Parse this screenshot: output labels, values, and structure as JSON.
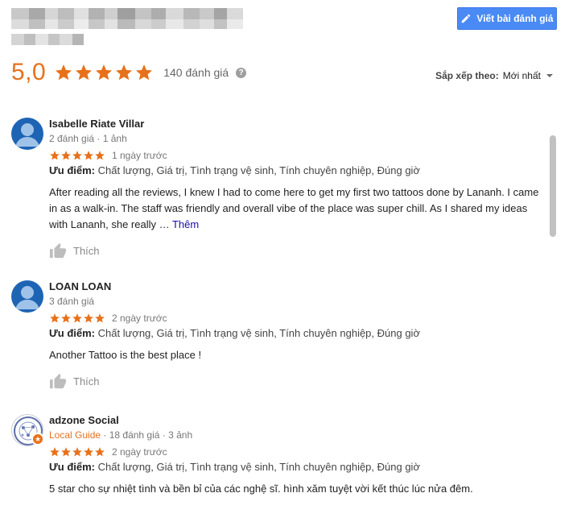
{
  "header": {
    "write_review_label": "Viết bài đánh giá"
  },
  "summary": {
    "score": "5,0",
    "rating": 5,
    "review_count": "140 đánh giá",
    "help_icon": "?"
  },
  "sort": {
    "label": "Sắp xếp theo:",
    "value": "Mới nhất"
  },
  "colors": {
    "star": "#e7711b",
    "accent_button": "#4a8af4",
    "link": "#1a0dab",
    "avatar": "#1e64b4"
  },
  "reviews": [
    {
      "name": "Isabelle Riate Villar",
      "meta": "2 đánh giá · 1 ảnh",
      "rating": 5,
      "time": "1 ngày trước",
      "pros_label": "Ưu điểm:",
      "pros": "Chất lượng, Giá trị, Tình trạng vệ sinh, Tính chuyên nghiệp, Đúng giờ",
      "text": "After reading all the reviews, I knew I had to come here to get my first two tattoos done by Lananh. I came in as a walk-in. The staff was friendly and overall vibe of the place was super chill. As I shared my ideas with Lananh, she really …",
      "more": "Thêm",
      "like_label": "Thích"
    },
    {
      "name": "LOAN LOAN",
      "meta": "3 đánh giá",
      "rating": 5,
      "time": "2 ngày trước",
      "pros_label": "Ưu điểm:",
      "pros": "Chất lượng, Giá trị, Tình trạng vệ sinh, Tính chuyên nghiệp, Đúng giờ",
      "text": "Another Tattoo is the best place !",
      "like_label": "Thích"
    },
    {
      "name": "adzone Social",
      "guide": "Local Guide",
      "meta": "· 18 đánh giá · 3 ảnh",
      "rating": 5,
      "time": "2 ngày trước",
      "pros_label": "Ưu điểm:",
      "pros": "Chất lượng, Giá trị, Tình trạng vệ sinh, Tính chuyên nghiệp, Đúng giờ",
      "text": "5 star cho sự nhiệt tình và bền bỉ của các nghệ sĩ. hình xăm tuyệt vời  kết thúc lúc nửa đêm."
    }
  ]
}
